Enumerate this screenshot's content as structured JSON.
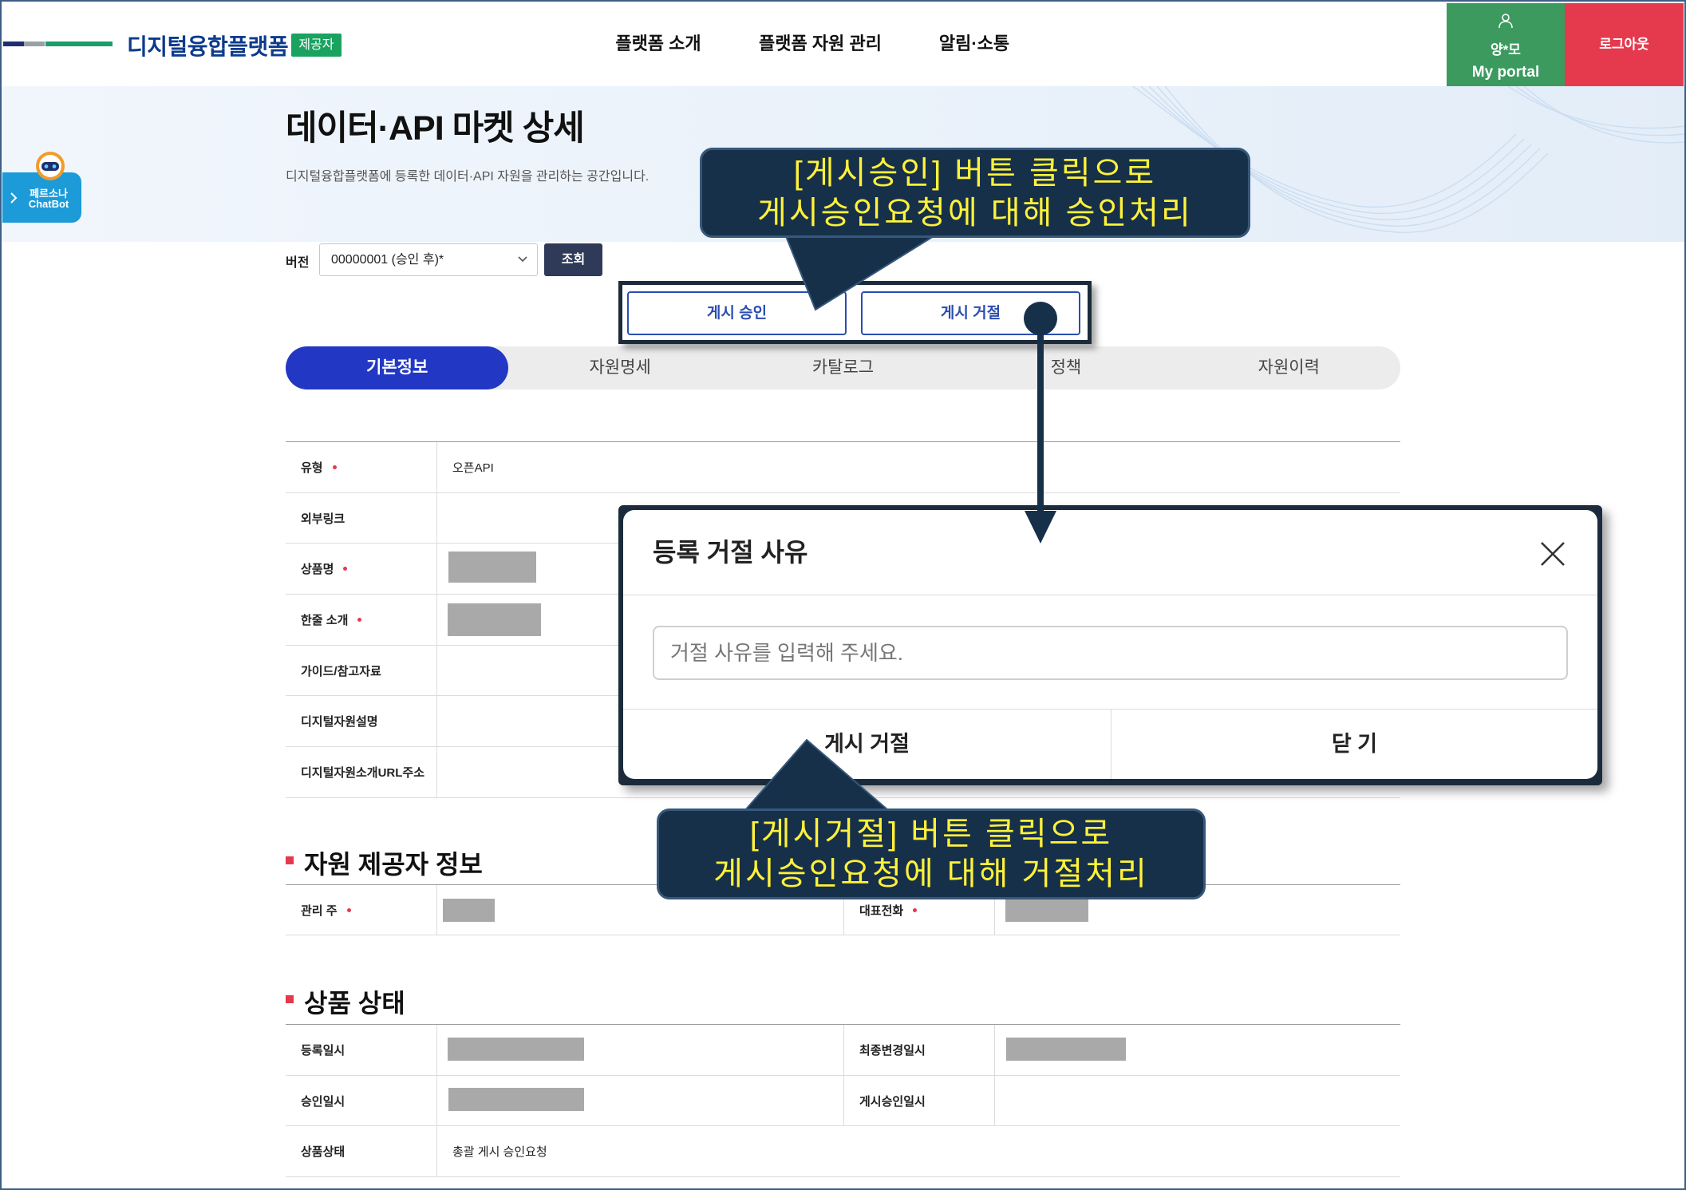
{
  "header": {
    "brand": "디지털융합플랫폼",
    "badge": "제공자",
    "nav": [
      "플랫폼 소개",
      "플랫폼 자원 관리",
      "알림·소통"
    ],
    "user_name": "양*모",
    "portal_label": "My portal",
    "logout": "로그아웃"
  },
  "chatbot": {
    "line1": "페르소나",
    "line2": "ChatBot"
  },
  "page": {
    "title": "데이터·API 마켓 상세",
    "subtitle": "디지털융합플랫폼에 등록한 데이터·API 자원을 관리하는 공간입니다."
  },
  "version": {
    "label": "버전",
    "selected": "00000001 (승인 후)*",
    "search_button": "조회"
  },
  "actions": {
    "approve": "게시 승인",
    "reject": "게시 거절"
  },
  "tabs": {
    "active": 0,
    "items": [
      "기본정보",
      "자원명세",
      "카탈로그",
      "정책",
      "자원이력"
    ]
  },
  "basic_info": {
    "rows": [
      {
        "label": "유형",
        "required": true,
        "value": "오픈API"
      },
      {
        "label": "외부링크",
        "required": false
      },
      {
        "label": "상품명",
        "required": true
      },
      {
        "label": "한줄 소개",
        "required": true
      },
      {
        "label": "가이드/참고자료",
        "required": false
      },
      {
        "label": "디지털자원설명",
        "required": false
      },
      {
        "label": "디지털자원소개URL주소",
        "required": false
      }
    ]
  },
  "provider_info": {
    "title": "자원 제공자 정보",
    "rows": [
      {
        "label": "관리 주",
        "required": true,
        "label2": "대표전화",
        "required2": true
      }
    ]
  },
  "product_status": {
    "title": "상품 상태",
    "rows": [
      {
        "label": "등록일시",
        "label2": "최종변경일시"
      },
      {
        "label": "승인일시",
        "label2": "게시승인일시"
      },
      {
        "label": "상품상태",
        "value": "총괄 게시 승인요청"
      }
    ]
  },
  "modal": {
    "title": "등록 거절 사유",
    "placeholder": "거절 사유를 입력해 주세요.",
    "reject_button": "게시 거절",
    "close_button": "닫 기"
  },
  "callouts": [
    {
      "line1": "[게시승인] 버튼 클릭으로",
      "line2": "게시승인요청에 대해 승인처리"
    },
    {
      "line1": "[게시거절] 버튼 클릭으로",
      "line2": "게시승인요청에 대해 거절처리"
    }
  ],
  "colors": {
    "primary_blue": "#2238c4",
    "portal_green": "#3c9a5f",
    "logout_red": "#e5394d",
    "badge_green": "#1aa260",
    "callout_bg": "#17304a",
    "callout_text": "#fff23a"
  },
  "icons": [
    "user-icon",
    "robot-icon",
    "chevron-right-icon",
    "chevron-down-icon",
    "close-icon"
  ]
}
